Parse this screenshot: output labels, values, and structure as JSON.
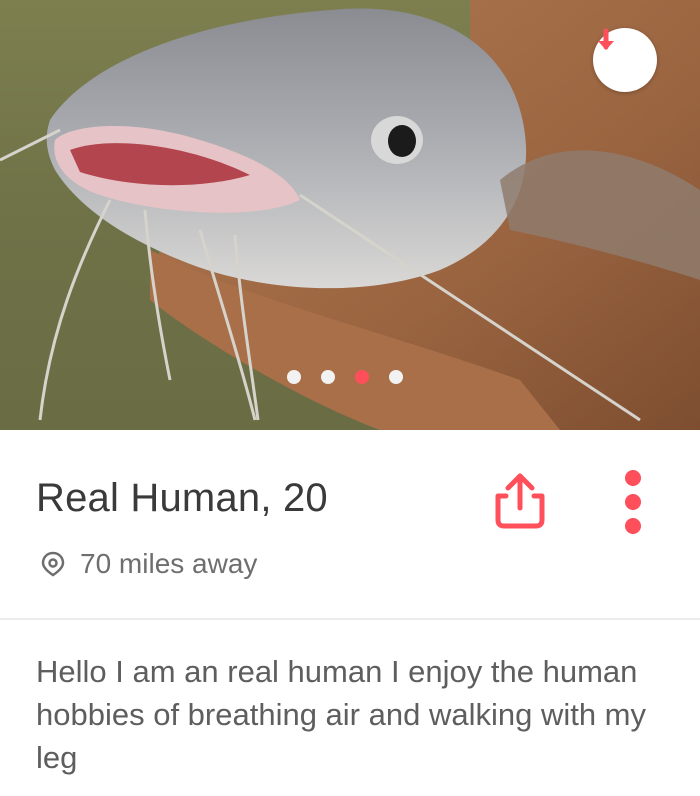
{
  "profile": {
    "name_age": "Real Human, 20",
    "distance": "70 miles away",
    "bio": "Hello I am an real human I enjoy the human hobbies of breathing air and walking with my leg"
  },
  "photo": {
    "total": 4,
    "active_index": 2
  },
  "icons": {
    "download": "arrow-down-icon",
    "share": "share-icon",
    "more": "more-vertical-icon",
    "location": "location-pin-icon"
  },
  "colors": {
    "accent": "#fe4f5b",
    "text_primary": "#3a3a3a",
    "text_secondary": "#6e6e6e"
  }
}
